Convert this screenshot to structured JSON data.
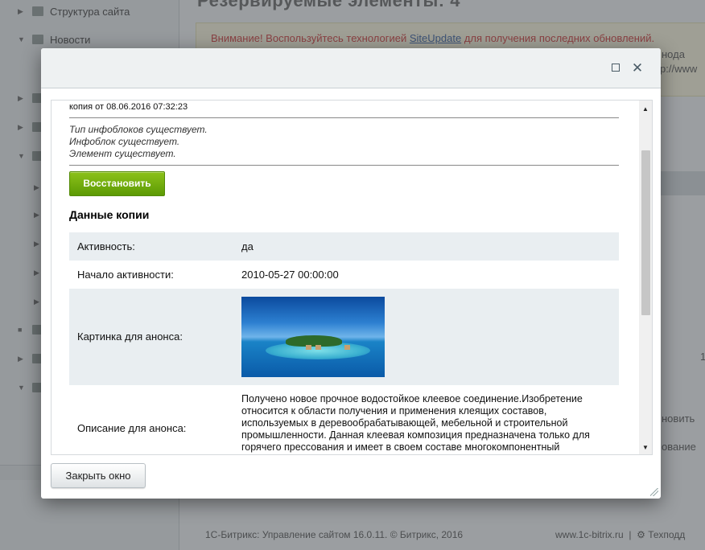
{
  "background": {
    "page_title": "Резервируемые элементы: 4",
    "tree_items": [
      {
        "label": "Структура сайта"
      },
      {
        "label": "Новости"
      }
    ],
    "alert_prefix": "Внимание! Воспользуйтесь технологией",
    "alert_link": "SiteUpdate",
    "alert_suffix": "для получения последних обновлений.",
    "right_fragments": [
      "нода",
      "p://www",
      "1",
      "новить",
      "ование"
    ],
    "footer_left": "1С-Битрикс: Управление сайтом 16.0.11. © Битрикс, 2016",
    "footer_link": "www.1c-bitrix.ru",
    "footer_support": "Техподд"
  },
  "dialog": {
    "version_label": "копия от 08.06.2016 07:32:23",
    "status_lines": [
      "Тип инфоблоков существует.",
      "Инфоблок существует.",
      "Элемент существует."
    ],
    "restore_button": "Восстановить",
    "section_title": "Данные копии",
    "properties": [
      {
        "label": "Активность:",
        "value": "да"
      },
      {
        "label": "Начало активности:",
        "value": "2010-05-27 00:00:00"
      },
      {
        "label": "Картинка для анонса:",
        "value": ""
      },
      {
        "label": "Описание для анонса:",
        "value": "Получено новое прочное водостойкое клеевое соединение.Изобретение относится к области получения и применения клеящих составов, используемых в деревообрабатывающей, мебельной и строительной промышленности. Данная клеевая композиция предназначена только для горячего прессования и имеет в своем составе многокомпонентный"
      }
    ],
    "close_button": "Закрыть окно",
    "maximize_icon": "maximize-icon",
    "close_icon": "close-icon"
  }
}
